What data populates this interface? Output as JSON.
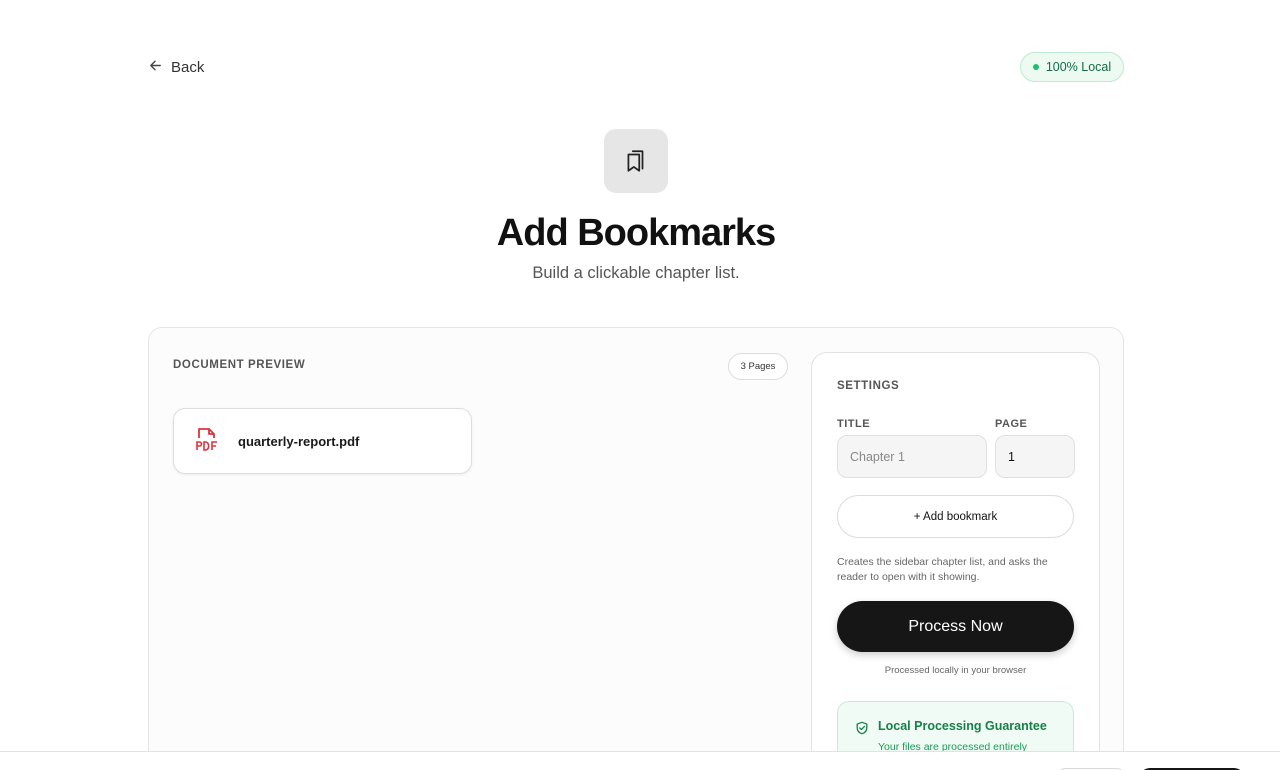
{
  "nav": {
    "back_label": "Back"
  },
  "badge": {
    "label": "100% Local"
  },
  "hero": {
    "icon": "bookmarks-icon",
    "title": "Add Bookmarks",
    "subtitle": "Build a clickable chapter list."
  },
  "preview": {
    "label": "DOCUMENT PREVIEW",
    "pages_badge": "3 Pages",
    "file": {
      "icon": "pdf-file-icon",
      "name": "quarterly-report.pdf"
    }
  },
  "settings": {
    "label": "SETTINGS",
    "title_field": {
      "label": "TITLE",
      "placeholder": "Chapter 1",
      "value": ""
    },
    "page_field": {
      "label": "PAGE",
      "value": "1"
    },
    "add_bookmark_label": "+ Add bookmark",
    "hint": "Creates the sidebar chapter list, and asks the reader to open with it showing.",
    "process_label": "Process Now",
    "process_note": "Processed locally in your browser",
    "guarantee": {
      "icon": "shield-check-icon",
      "title": "Local Processing Guarantee",
      "text": "Your files are processed entirely"
    }
  },
  "colors": {
    "accent_green": "#1fbf6a",
    "pdf_red": "#e0313b",
    "primary_dark": "#161616"
  }
}
